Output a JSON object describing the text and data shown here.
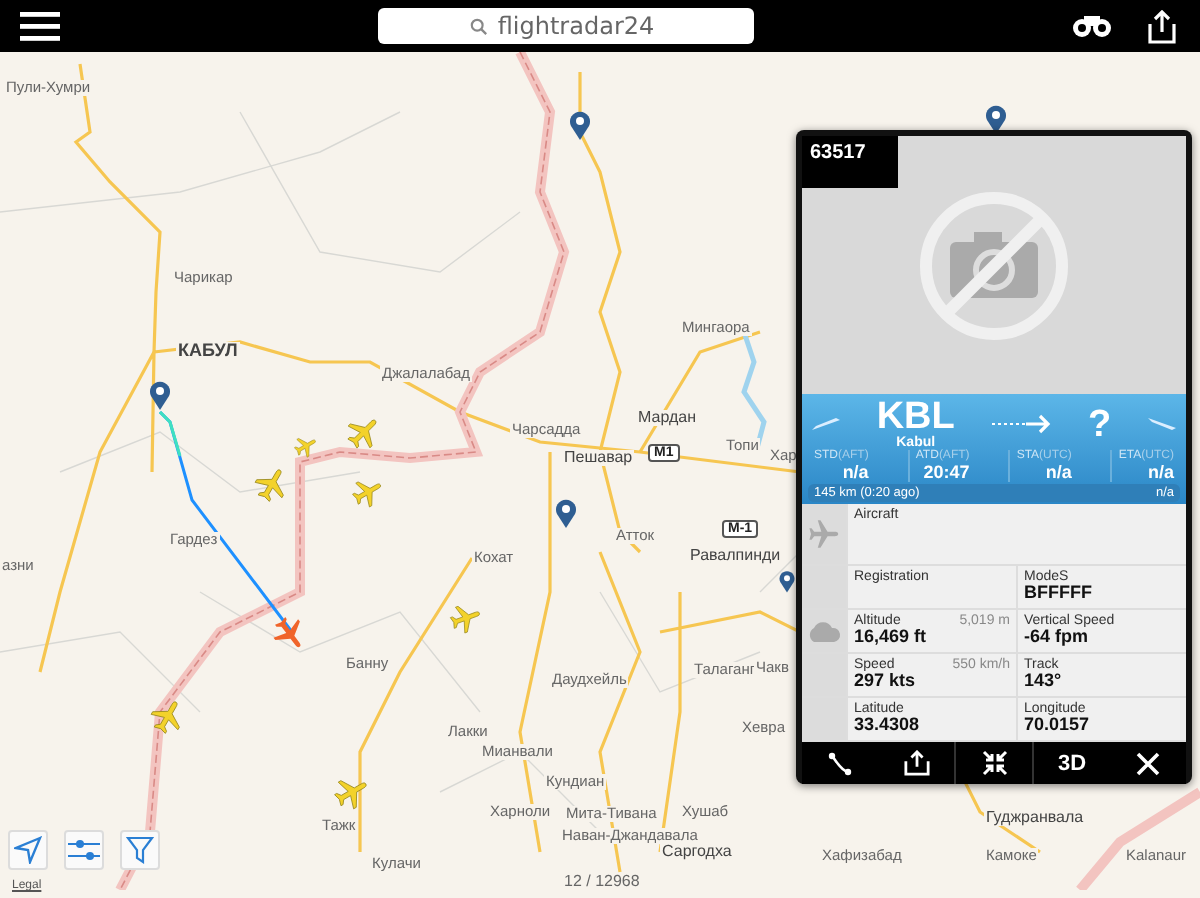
{
  "top_bar": {
    "search": {
      "placeholder": "flightradar24"
    }
  },
  "map": {
    "labels": [
      {
        "text": "Пули-Хумри",
        "kind": "town"
      },
      {
        "text": "Чарикар",
        "kind": "town"
      },
      {
        "text": "КАБУЛ",
        "kind": "capital"
      },
      {
        "text": "Джалалабад",
        "kind": "town"
      },
      {
        "text": "Мингаора",
        "kind": "town"
      },
      {
        "text": "Чарсадда",
        "kind": "town"
      },
      {
        "text": "Мардан",
        "kind": "city"
      },
      {
        "text": "Пешавар",
        "kind": "city"
      },
      {
        "text": "M1",
        "kind": "road"
      },
      {
        "text": "Топи",
        "kind": "town"
      },
      {
        "text": "Хар",
        "kind": "town"
      },
      {
        "text": "Гардез",
        "kind": "town"
      },
      {
        "text": "Атток",
        "kind": "town"
      },
      {
        "text": "азни",
        "kind": "town"
      },
      {
        "text": "M-1",
        "kind": "road"
      },
      {
        "text": "Кохат",
        "kind": "town"
      },
      {
        "text": "Равалпинди",
        "kind": "city"
      },
      {
        "text": "Банну",
        "kind": "town"
      },
      {
        "text": "Даудхейль",
        "kind": "town"
      },
      {
        "text": "Талаганг",
        "kind": "town"
      },
      {
        "text": "Чакв",
        "kind": "town"
      },
      {
        "text": "Хевра",
        "kind": "town"
      },
      {
        "text": "Лакки",
        "kind": "town"
      },
      {
        "text": "Мианвали",
        "kind": "town"
      },
      {
        "text": "Кундиан",
        "kind": "town"
      },
      {
        "text": "Харноли",
        "kind": "town"
      },
      {
        "text": "Мита-Тивана",
        "kind": "town"
      },
      {
        "text": "Хушаб",
        "kind": "town"
      },
      {
        "text": "Наван-Джандавала",
        "kind": "town"
      },
      {
        "text": "Саргодха",
        "kind": "city"
      },
      {
        "text": "Тажк",
        "kind": "town"
      },
      {
        "text": "Кулачи",
        "kind": "town"
      },
      {
        "text": "Хафизабад",
        "kind": "town"
      },
      {
        "text": "Гуджранвала",
        "kind": "city"
      },
      {
        "text": "Камоке",
        "kind": "town"
      },
      {
        "text": "Kalanaur",
        "kind": "town"
      }
    ],
    "counter": "12 / 12968",
    "legal": "Legal"
  },
  "flight_panel": {
    "badge": "63517",
    "origin": {
      "code": "KBL",
      "name": "Kabul"
    },
    "destination": {
      "code": "?"
    },
    "times": [
      {
        "label": "STD",
        "zone": "(AFT)",
        "value": "n/a"
      },
      {
        "label": "ATD",
        "zone": "(AFT)",
        "value": "20:47"
      },
      {
        "label": "STA",
        "zone": "(UTC)",
        "value": "n/a"
      },
      {
        "label": "ETA",
        "zone": "(UTC)",
        "value": "n/a"
      }
    ],
    "progress": {
      "distance": "145 km (0:20 ago)",
      "remaining": "n/a"
    },
    "details": [
      {
        "cells": [
          {
            "label": "Aircraft"
          }
        ]
      },
      {
        "cells": [
          {
            "label": "Registration"
          },
          {
            "label": "ModeS",
            "value": "BFFFFF"
          }
        ]
      },
      {
        "cells": [
          {
            "label": "Altitude",
            "note": "5,019 m",
            "value": "16,469 ft"
          },
          {
            "label": "Vertical Speed",
            "value": "-64 fpm"
          }
        ]
      },
      {
        "cells": [
          {
            "label": "Speed",
            "note": "550 km/h",
            "value": "297 kts"
          },
          {
            "label": "Track",
            "value": "143°"
          }
        ]
      },
      {
        "cells": [
          {
            "label": "Latitude",
            "value": "33.4308"
          },
          {
            "label": "Longitude",
            "value": "70.0157"
          }
        ]
      }
    ],
    "toolbar": [
      {
        "kind": "route"
      },
      {
        "kind": "share"
      },
      {
        "kind": "collapse"
      },
      {
        "kind": "text",
        "text": "3D"
      },
      {
        "kind": "close"
      }
    ]
  }
}
